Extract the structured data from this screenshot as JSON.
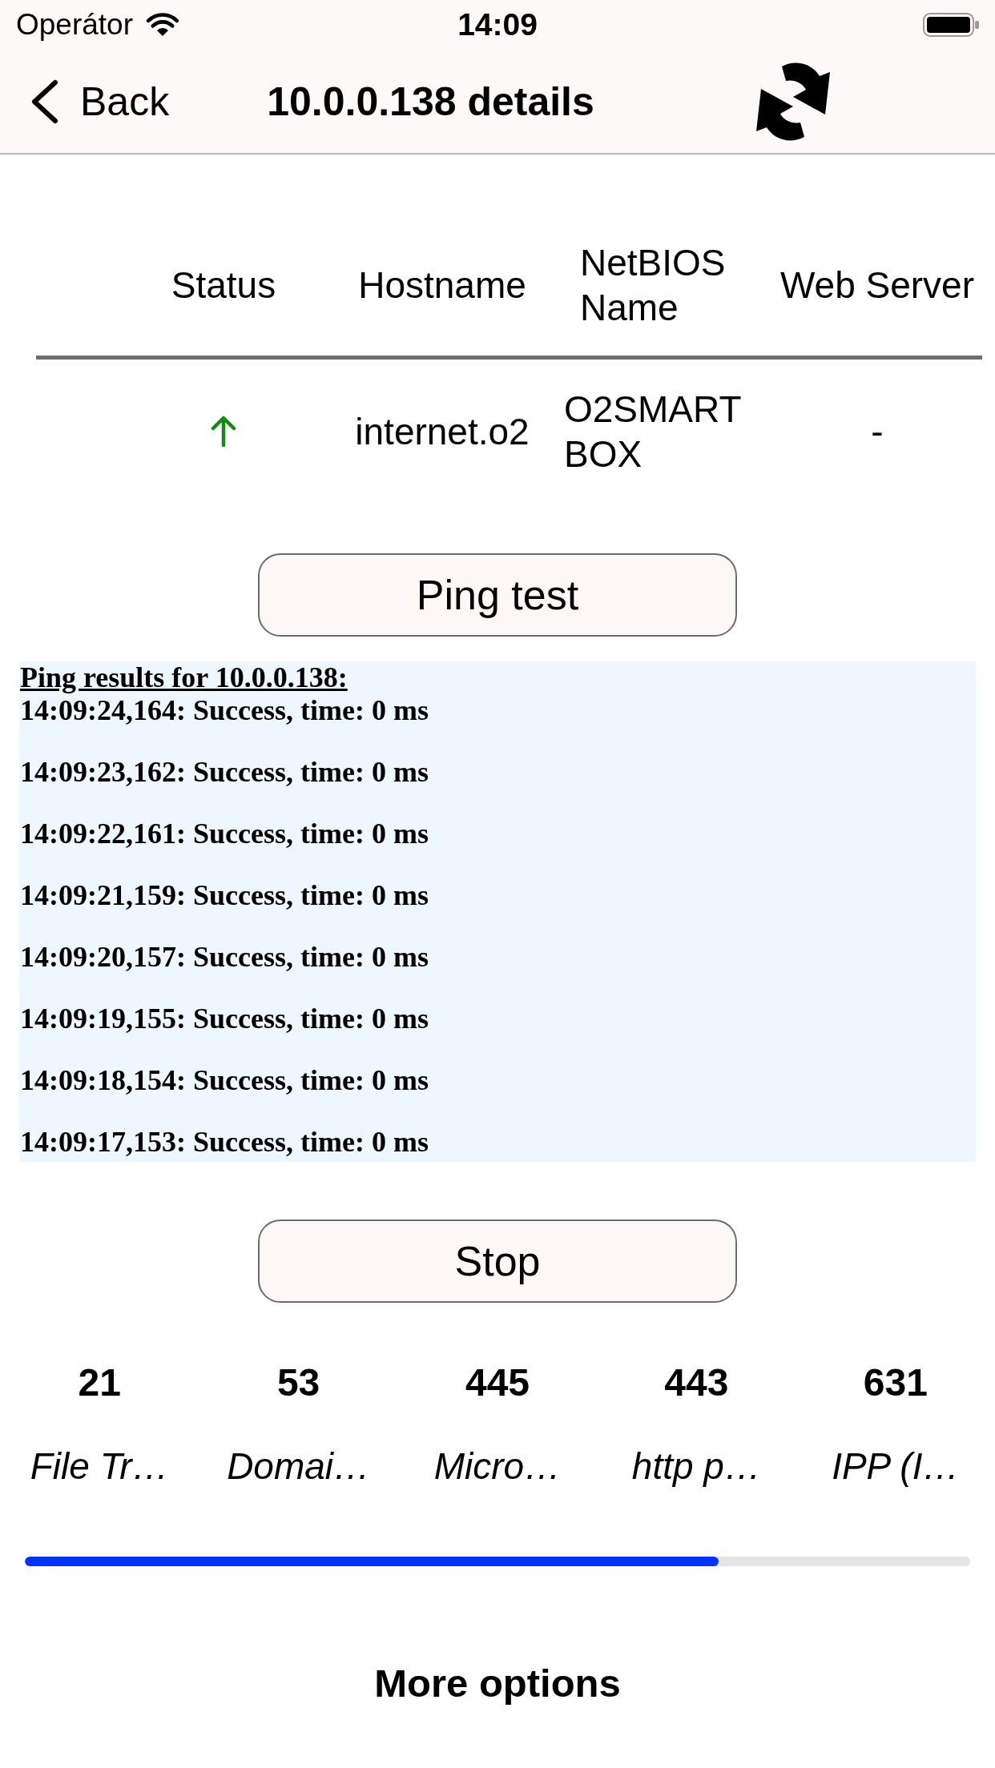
{
  "status_bar": {
    "carrier": "Operátor",
    "time": "14:09"
  },
  "nav": {
    "back": "Back",
    "title": "10.0.0.138 details"
  },
  "table": {
    "columns": [
      "Status",
      "Hostname",
      "NetBIOS Name",
      "Web Server"
    ],
    "rows": [
      {
        "online": true,
        "hostname": "internet.o2",
        "netbios_name": "O2SMART BOX",
        "web_server": "-"
      }
    ]
  },
  "ping_button": "Ping test",
  "ping_results": {
    "title": "Ping results for 10.0.0.138:",
    "lines": [
      "14:09:24,164: Success, time: 0 ms",
      "14:09:23,162: Success, time: 0 ms",
      "14:09:22,161: Success, time: 0 ms",
      "14:09:21,159: Success, time: 0 ms",
      "14:09:20,157: Success, time: 0 ms",
      "14:09:19,155: Success, time: 0 ms",
      "14:09:18,154: Success, time: 0 ms",
      "14:09:17,153: Success, time: 0 ms"
    ]
  },
  "stop_button": "Stop",
  "ports": [
    {
      "number": "21",
      "name": "File Tr…"
    },
    {
      "number": "53",
      "name": "Domai…"
    },
    {
      "number": "445",
      "name": "Micro…"
    },
    {
      "number": "443",
      "name": "http p…"
    },
    {
      "number": "631",
      "name": "IPP (I…"
    }
  ],
  "progress": {
    "level": 0.734
  },
  "more_options": "More options"
}
